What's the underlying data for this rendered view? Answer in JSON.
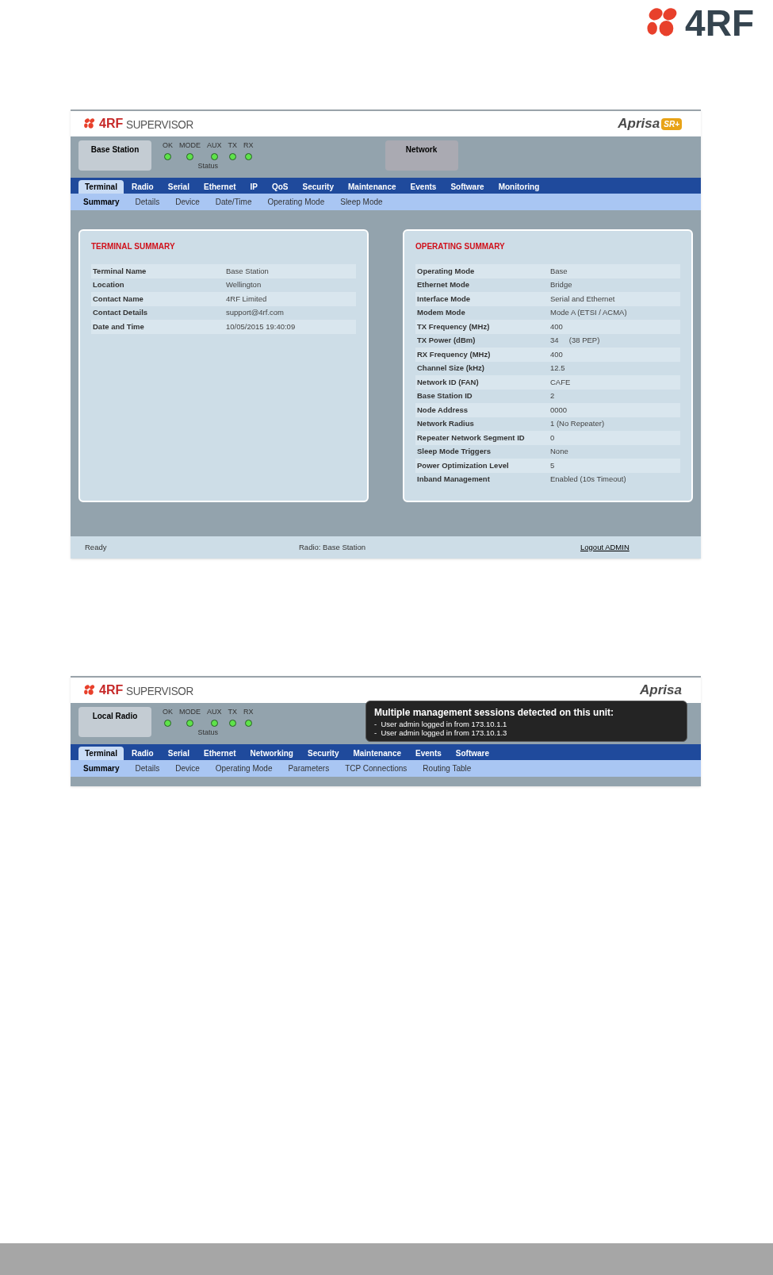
{
  "page_logo": "4RF",
  "screens": [
    {
      "header": {
        "logo": "4RF",
        "product": "SUPERVISOR",
        "brand": "Aprisa",
        "badge": "SR+"
      },
      "station": "Base Station",
      "leds": [
        {
          "label": "OK",
          "on": true
        },
        {
          "label": "MODE",
          "on": true
        },
        {
          "label": "AUX",
          "on": true
        },
        {
          "label": "TX",
          "on": true
        },
        {
          "label": "RX",
          "on": true
        }
      ],
      "status_label": "Status",
      "network": "Network",
      "tabs": [
        {
          "label": "Terminal",
          "selected": true
        },
        {
          "label": "Radio",
          "selected": false
        },
        {
          "label": "Serial",
          "selected": false
        },
        {
          "label": "Ethernet",
          "selected": false
        },
        {
          "label": "IP",
          "selected": false
        },
        {
          "label": "QoS",
          "selected": false
        },
        {
          "label": "Security",
          "selected": false
        },
        {
          "label": "Maintenance",
          "selected": false
        },
        {
          "label": "Events",
          "selected": false
        },
        {
          "label": "Software",
          "selected": false
        },
        {
          "label": "Monitoring",
          "selected": false
        }
      ],
      "subtabs": [
        {
          "label": "Summary",
          "selected": true
        },
        {
          "label": "Details",
          "selected": false
        },
        {
          "label": "Device",
          "selected": false
        },
        {
          "label": "Date/Time",
          "selected": false
        },
        {
          "label": "Operating Mode",
          "selected": false
        },
        {
          "label": "Sleep Mode",
          "selected": false
        }
      ],
      "panels": [
        {
          "title": "TERMINAL SUMMARY",
          "rows": [
            {
              "label": "Terminal Name",
              "value": "Base Station"
            },
            {
              "label": "Location",
              "value": "Wellington"
            },
            {
              "label": "Contact Name",
              "value": "4RF Limited"
            },
            {
              "label": "Contact Details",
              "value": "support@4rf.com"
            },
            {
              "label": "Date and Time",
              "value": "10/05/2015 19:40:09"
            }
          ]
        },
        {
          "title": "OPERATING SUMMARY",
          "rows": [
            {
              "label": "Operating Mode",
              "value": "Base"
            },
            {
              "label": "Ethernet Mode",
              "value": "Bridge"
            },
            {
              "label": "Interface Mode",
              "value": "Serial and Ethernet"
            },
            {
              "label": "Modem Mode",
              "value": "Mode A (ETSI / ACMA)"
            },
            {
              "label": "TX Frequency (MHz)",
              "value": "400"
            },
            {
              "label": "TX Power (dBm)",
              "value": "34     (38 PEP)"
            },
            {
              "label": "RX Frequency (MHz)",
              "value": "400"
            },
            {
              "label": "Channel Size (kHz)",
              "value": "12.5"
            },
            {
              "label": "Network ID (FAN)",
              "value": "CAFE"
            },
            {
              "label": "Base Station ID",
              "value": "2"
            },
            {
              "label": "Node Address",
              "value": "0000"
            },
            {
              "label": "Network Radius",
              "value": "1 (No Repeater)"
            },
            {
              "label": "Repeater Network Segment ID",
              "value": "0"
            },
            {
              "label": "Sleep Mode Triggers",
              "value": "None"
            },
            {
              "label": "Power Optimization Level",
              "value": "5"
            },
            {
              "label": "Inband Management",
              "value": "Enabled (10s Timeout)"
            }
          ]
        }
      ],
      "footer": {
        "status": "Ready",
        "radio": "Radio: Base Station",
        "logout": "Logout ADMIN"
      }
    },
    {
      "header": {
        "logo": "4RF",
        "product": "SUPERVISOR",
        "brand": "Aprisa"
      },
      "station": "Local Radio",
      "leds": [
        {
          "label": "OK",
          "on": true
        },
        {
          "label": "MODE",
          "on": true
        },
        {
          "label": "AUX",
          "on": true
        },
        {
          "label": "TX",
          "on": true
        },
        {
          "label": "RX",
          "on": true
        }
      ],
      "status_label": "Status",
      "tabs": [
        {
          "label": "Terminal",
          "selected": true
        },
        {
          "label": "Radio",
          "selected": false
        },
        {
          "label": "Serial",
          "selected": false
        },
        {
          "label": "Ethernet",
          "selected": false
        },
        {
          "label": "Networking",
          "selected": false
        },
        {
          "label": "Security",
          "selected": false
        },
        {
          "label": "Maintenance",
          "selected": false
        },
        {
          "label": "Events",
          "selected": false
        },
        {
          "label": "Software",
          "selected": false
        }
      ],
      "subtabs": [
        {
          "label": "Summary",
          "selected": true
        },
        {
          "label": "Details",
          "selected": false
        },
        {
          "label": "Device",
          "selected": false
        },
        {
          "label": "Operating Mode",
          "selected": false
        },
        {
          "label": "Parameters",
          "selected": false
        },
        {
          "label": "TCP Connections",
          "selected": false
        },
        {
          "label": "Routing Table",
          "selected": false
        }
      ],
      "notice": {
        "title": "Multiple management sessions detected on this unit:",
        "lines": [
          "-  User admin logged in from 173.10.1.1",
          "-  User admin logged in from 173.10.1.3"
        ]
      }
    }
  ]
}
